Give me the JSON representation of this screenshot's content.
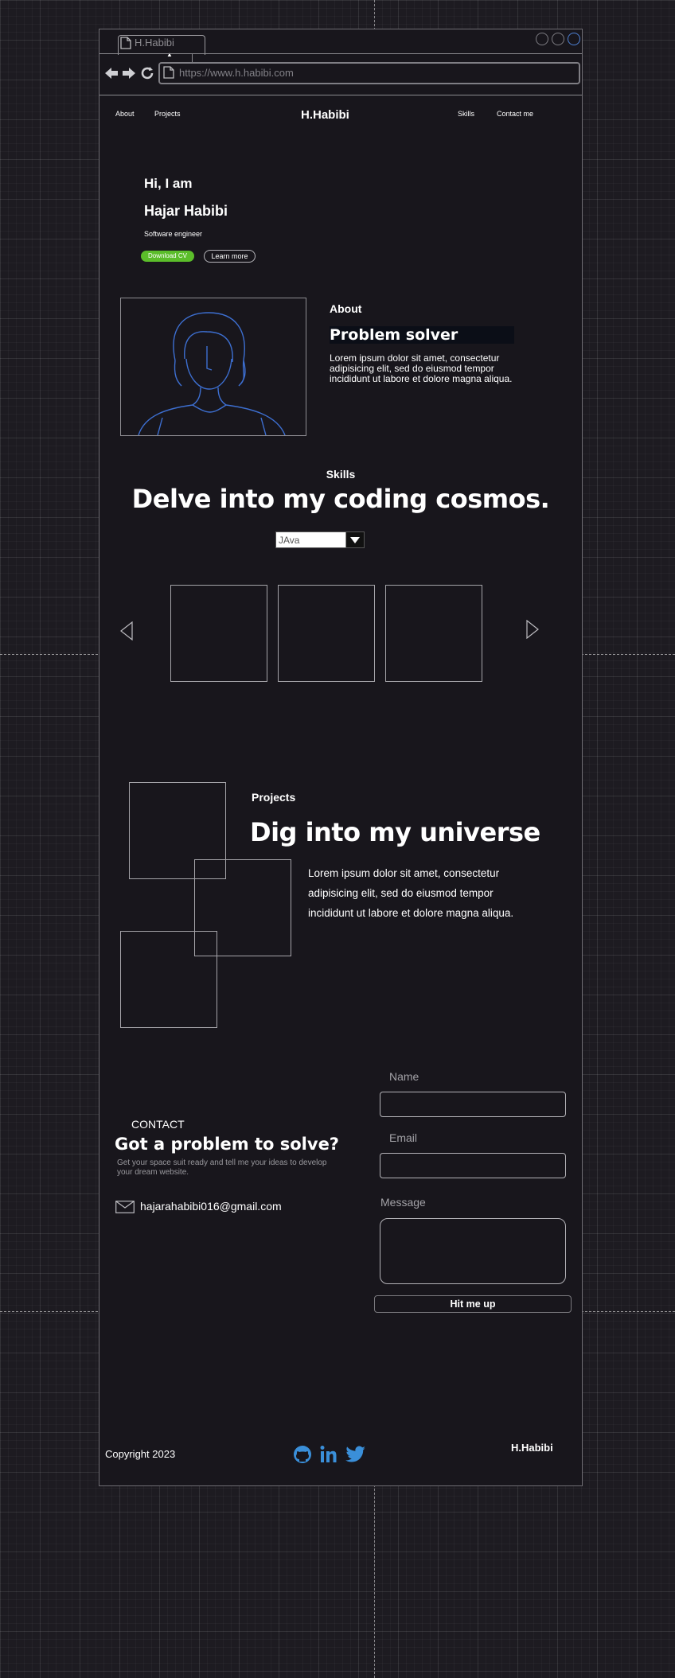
{
  "browser": {
    "tab_title": "H.Habibi",
    "url": "https://www.h.habibi.com"
  },
  "nav": {
    "about": "About",
    "projects": "Projects",
    "brand": "H.Habibi",
    "skills": "Skills",
    "contact": "Contact me"
  },
  "hero": {
    "greeting": "Hi, I am",
    "name": "Hajar Habibi",
    "role": "Software engineer",
    "download_cv": "Download CV",
    "learn_more": "Learn more"
  },
  "about": {
    "label": "About",
    "heading": "Problem solver",
    "body": "Lorem ipsum dolor sit amet, consectetur adipisicing elit, sed do eiusmod tempor incididunt ut labore et dolore magna aliqua."
  },
  "skills": {
    "label": "Skills",
    "heading": "Delve into my coding cosmos.",
    "selected_language": "JAva"
  },
  "projects": {
    "label": "Projects",
    "heading": "Dig into my universe",
    "body": "Lorem ipsum dolor sit amet, consectetur adipisicing elit, sed do eiusmod tempor incididunt ut labore et dolore magna aliqua."
  },
  "contact": {
    "label": "CONTACT",
    "heading": "Got a problem to solve?",
    "subtext": "Get your space suit ready and tell me your ideas to develop your dream website.",
    "email": "hajarahabibi016@gmail.com",
    "name_label": "Name",
    "email_label": "Email",
    "message_label": "Message",
    "submit": "Hit me up"
  },
  "footer": {
    "copyright": "Copyright 2023",
    "brand": "H.Habibi"
  },
  "colors": {
    "page_bg": "#1d1b21",
    "frame_bg": "#18161c",
    "accent_green": "#5bbd2a",
    "social_blue": "#3a8fd9",
    "avatar_line": "#3d6fd1",
    "highlight_bg": "#0b0e17"
  },
  "icons": [
    "file-icon",
    "back-arrow-icon",
    "forward-arrow-icon",
    "reload-icon",
    "chevron-down-icon",
    "chevron-left-icon",
    "chevron-right-icon",
    "mail-icon",
    "github-icon",
    "linkedin-icon",
    "twitter-icon"
  ]
}
